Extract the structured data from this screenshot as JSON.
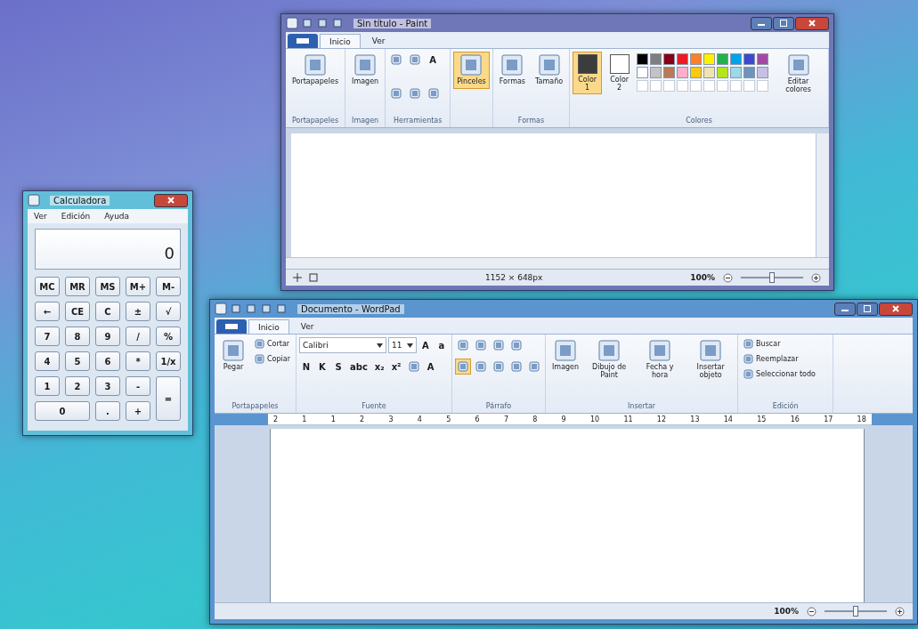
{
  "paint": {
    "title": "Sin título - Paint",
    "tabs": [
      {
        "label": "Inicio",
        "selected": true
      },
      {
        "label": "Ver",
        "selected": false
      }
    ],
    "ribbon": [
      {
        "label": "Portapapeles",
        "items": [
          {
            "kind": "big",
            "label": "Portapapeles",
            "selected": false
          }
        ]
      },
      {
        "label": "Imagen",
        "items": [
          {
            "kind": "big",
            "label": "Imagen",
            "selected": false
          }
        ]
      },
      {
        "label": "Herramientas",
        "items": [
          {
            "kind": "icon",
            "selected": false
          },
          {
            "kind": "icon",
            "selected": false
          },
          {
            "kind": "glyph",
            "label": "A",
            "selected": false
          },
          {
            "kind": "icon",
            "selected": false
          },
          {
            "kind": "icon",
            "selected": false
          },
          {
            "kind": "icon",
            "selected": false
          }
        ]
      },
      {
        "items": [
          {
            "kind": "big",
            "label": "Pinceles",
            "selected": true
          }
        ]
      },
      {
        "label": "Formas",
        "items": [
          {
            "kind": "big",
            "label": "Formas",
            "selected": false
          },
          {
            "kind": "big",
            "label": "Tamaño",
            "selected": false
          }
        ]
      },
      {
        "label": "Colores",
        "items": [
          {
            "kind": "color",
            "label": "Color 1",
            "color": "#3c3c3c",
            "selected": true
          },
          {
            "kind": "color",
            "label": "Color 2",
            "color": "#ffffff",
            "selected": false
          },
          {
            "kind": "palette",
            "swatches": [
              {
                "color": "#000000"
              },
              {
                "color": "#7f7f7f"
              },
              {
                "color": "#880015"
              },
              {
                "color": "#ed1c24"
              },
              {
                "color": "#ff7f27"
              },
              {
                "color": "#fff200"
              },
              {
                "color": "#22b14c"
              },
              {
                "color": "#00a2e8"
              },
              {
                "color": "#3f48cc"
              },
              {
                "color": "#a349a4"
              },
              {
                "color": "#ffffff"
              },
              {
                "color": "#c3c3c3"
              },
              {
                "color": "#b97a57"
              },
              {
                "color": "#ffaec9"
              },
              {
                "color": "#ffc90e"
              },
              {
                "color": "#efe4b0"
              },
              {
                "color": "#b5e61d"
              },
              {
                "color": "#99d9ea"
              },
              {
                "color": "#7092be"
              },
              {
                "color": "#c8bfe7"
              }
            ]
          },
          {
            "kind": "big",
            "label": "Editar colores",
            "selected": false
          }
        ]
      }
    ],
    "status_bar": {
      "size": "1152 × 648px",
      "zoom": "100%",
      "level": 0.5
    }
  },
  "calculator": {
    "title": "Calculadora",
    "menu": [
      "Ver",
      "Edición",
      "Ayuda"
    ],
    "display": "0",
    "keys": [
      {
        "label": "MC",
        "kind": "key"
      },
      {
        "label": "MR",
        "kind": "key"
      },
      {
        "label": "MS",
        "kind": "key"
      },
      {
        "label": "M+",
        "kind": "key"
      },
      {
        "label": "M-",
        "kind": "key"
      },
      {
        "label": "←",
        "kind": "key"
      },
      {
        "label": "CE",
        "kind": "key"
      },
      {
        "label": "C",
        "kind": "key"
      },
      {
        "label": "±",
        "kind": "key"
      },
      {
        "label": "√",
        "kind": "key"
      },
      {
        "label": "7",
        "kind": "key"
      },
      {
        "label": "8",
        "kind": "key"
      },
      {
        "label": "9",
        "kind": "key"
      },
      {
        "label": "/",
        "kind": "key"
      },
      {
        "label": "%",
        "kind": "key"
      },
      {
        "label": "4",
        "kind": "key"
      },
      {
        "label": "5",
        "kind": "key"
      },
      {
        "label": "6",
        "kind": "key"
      },
      {
        "label": "*",
        "kind": "key"
      },
      {
        "label": "1/x",
        "kind": "key"
      },
      {
        "label": "1",
        "kind": "key"
      },
      {
        "label": "2",
        "kind": "key"
      },
      {
        "label": "3",
        "kind": "key"
      },
      {
        "label": "-",
        "kind": "key"
      },
      {
        "label": "=",
        "kind": "tall"
      },
      {
        "label": "0",
        "kind": "wide"
      },
      {
        "label": ".",
        "kind": "key"
      },
      {
        "label": "+",
        "kind": "key"
      }
    ]
  },
  "wordpad": {
    "title": "Documento - WordPad",
    "tabs": [
      {
        "label": "Inicio",
        "selected": true
      },
      {
        "label": "Ver",
        "selected": false
      }
    ],
    "ribbon": [
      {
        "label": "Portapapeles",
        "items": [
          {
            "kind": "big",
            "label": "Pegar",
            "selected": false
          },
          {
            "kind": "stack",
            "items": [
              {
                "kind": "small",
                "label": "Cortar"
              },
              {
                "kind": "small",
                "label": "Copiar"
              }
            ]
          }
        ]
      },
      {
        "label": "Fuente",
        "items": [
          {
            "kind": "lines",
            "lines": [
              {
                "items": [
                  {
                    "kind": "combo",
                    "label": "Calibri"
                  },
                  {
                    "kind": "smallcombo",
                    "label": "11"
                  },
                  {
                    "kind": "glyph",
                    "label": "A",
                    "selected": false
                  },
                  {
                    "kind": "glyph",
                    "label": "a",
                    "selected": false
                  }
                ]
              },
              {
                "items": [
                  {
                    "kind": "glyph",
                    "label": "N",
                    "selected": false
                  },
                  {
                    "kind": "glyph",
                    "label": "K",
                    "selected": false
                  },
                  {
                    "kind": "glyph",
                    "label": "S",
                    "selected": false
                  },
                  {
                    "kind": "glyph",
                    "label": "abc",
                    "selected": false
                  },
                  {
                    "kind": "glyph",
                    "label": "x₂",
                    "selected": false
                  },
                  {
                    "kind": "glyph",
                    "label": "x²",
                    "selected": false
                  },
                  {
                    "kind": "icon",
                    "selected": false
                  },
                  {
                    "kind": "glyph",
                    "label": "A",
                    "selected": false
                  }
                ]
              }
            ]
          }
        ]
      },
      {
        "label": "Párrafo",
        "items": [
          {
            "kind": "lines",
            "lines": [
              {
                "items": [
                  {
                    "kind": "icon",
                    "selected": false
                  },
                  {
                    "kind": "icon",
                    "selected": false
                  },
                  {
                    "kind": "icon",
                    "selected": false
                  },
                  {
                    "kind": "icon",
                    "selected": false
                  }
                ]
              },
              {
                "items": [
                  {
                    "kind": "icon",
                    "selected": true
                  },
                  {
                    "kind": "icon",
                    "selected": false
                  },
                  {
                    "kind": "icon",
                    "selected": false
                  },
                  {
                    "kind": "icon",
                    "selected": false
                  },
                  {
                    "kind": "icon",
                    "selected": false
                  }
                ]
              }
            ]
          }
        ]
      },
      {
        "label": "Insertar",
        "items": [
          {
            "kind": "big",
            "label": "Imagen",
            "selected": false
          },
          {
            "kind": "big",
            "label": "Dibujo de Paint",
            "selected": false
          },
          {
            "kind": "big",
            "label": "Fecha y hora",
            "selected": false
          },
          {
            "kind": "big",
            "label": "Insertar objeto",
            "selected": false
          }
        ]
      },
      {
        "label": "Edición",
        "items": [
          {
            "kind": "stack",
            "items": [
              {
                "kind": "small",
                "label": "Buscar"
              },
              {
                "kind": "small",
                "label": "Reemplazar"
              },
              {
                "kind": "small",
                "label": "Seleccionar todo"
              }
            ]
          }
        ]
      }
    ],
    "ruler": [
      "2",
      "1",
      "1",
      "2",
      "3",
      "4",
      "5",
      "6",
      "7",
      "8",
      "9",
      "10",
      "11",
      "12",
      "13",
      "14",
      "15",
      "16",
      "17",
      "18"
    ],
    "status_bar": {
      "zoom": "100%",
      "level": 0.5
    }
  }
}
